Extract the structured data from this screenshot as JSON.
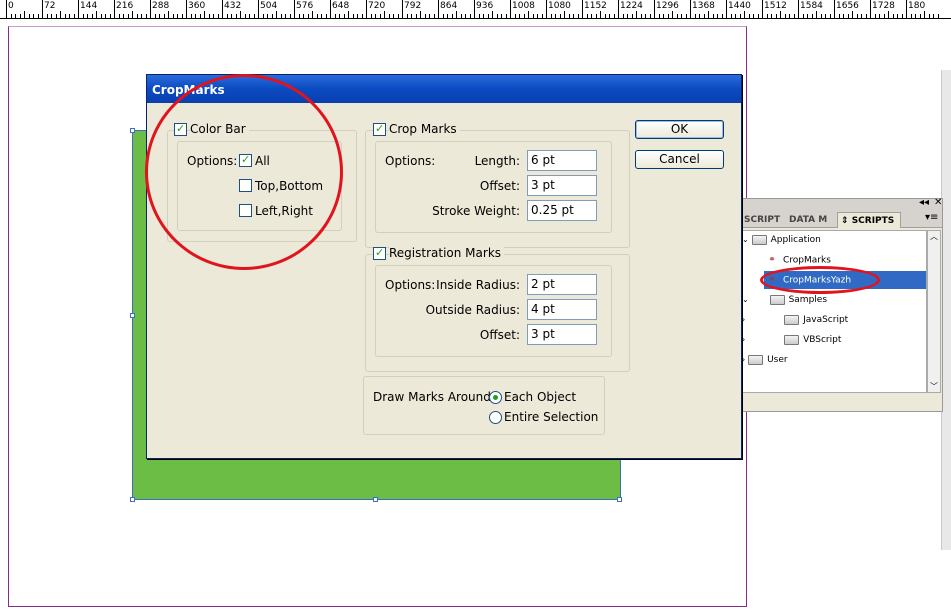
{
  "ruler": {
    "labels": [
      "0",
      "72",
      "144",
      "216",
      "288",
      "360",
      "432",
      "504",
      "576",
      "648",
      "720",
      "792",
      "864",
      "936",
      "1008",
      "1080",
      "1152",
      "1224",
      "1296",
      "1368",
      "1440",
      "1512",
      "1584",
      "1656",
      "1728",
      "180"
    ]
  },
  "dialog": {
    "title": "CropMarks",
    "color_bar": {
      "label": "Color Bar",
      "checked": true,
      "options_label": "Options:",
      "all": {
        "label": "All",
        "checked": true
      },
      "top_bottom": {
        "label": "Top,Bottom",
        "checked": false
      },
      "left_right": {
        "label": "Left,Right",
        "checked": false
      }
    },
    "crop_marks": {
      "label": "Crop Marks",
      "checked": true,
      "options_label": "Options:",
      "length_label": "Length:",
      "length_value": "6 pt",
      "offset_label": "Offset:",
      "offset_value": "3 pt",
      "stroke_label": "Stroke Weight:",
      "stroke_value": "0.25 pt"
    },
    "registration_marks": {
      "label": "Registration Marks",
      "checked": true,
      "options_label": "Options:",
      "inside_label": "Inside Radius:",
      "inside_value": "2 pt",
      "outside_label": "Outside Radius:",
      "outside_value": "4 pt",
      "offset_label": "Offset:",
      "offset_value": "3 pt"
    },
    "draw_marks": {
      "label": "Draw Marks Around:",
      "each_object": "Each Object",
      "entire_selection": "Entire Selection",
      "selected": "each_object"
    },
    "ok_label": "OK",
    "cancel_label": "Cancel"
  },
  "scripts_panel": {
    "tabs": [
      "SCRIPT L",
      "DATA M",
      "SCRIPTS"
    ],
    "active_tab": "SCRIPTS",
    "items": [
      {
        "label": "Application",
        "type": "folder"
      },
      {
        "label": "CropMarks",
        "type": "script"
      },
      {
        "label": "CropMarksYazh",
        "type": "script",
        "selected": true
      },
      {
        "label": "Samples",
        "type": "folder"
      },
      {
        "label": "JavaScript",
        "type": "folder"
      },
      {
        "label": "VBScript",
        "type": "folder"
      },
      {
        "label": "User",
        "type": "folder"
      }
    ]
  },
  "colors": {
    "accent": "#0b4ac2",
    "selection": "#316ac5",
    "highlight_circle": "#e0141c",
    "shape_fill": "#6cbd45"
  }
}
